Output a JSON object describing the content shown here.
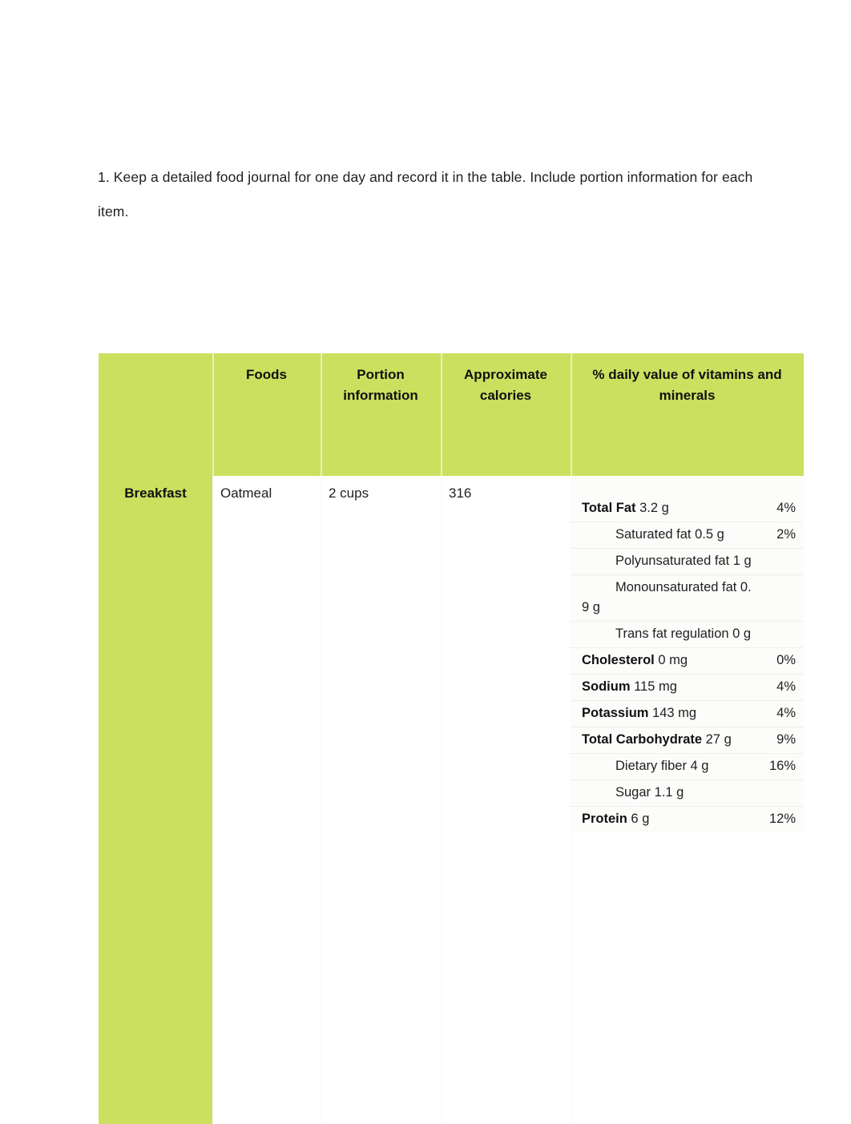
{
  "document": {
    "instruction": "1. Keep a detailed food journal for one day and record it in the table. Include portion information for each item."
  },
  "table": {
    "headers": {
      "corner": "",
      "foods": "Foods",
      "portion": "Portion information",
      "calories": "Approximate calories",
      "daily_value": "% daily value of vitamins and minerals"
    },
    "rows": [
      {
        "meal": "Breakfast",
        "food": "Oatmeal",
        "portion": "2 cups",
        "calories": "316",
        "nutrition": [
          {
            "name": "Total Fat",
            "amount": "3.2 g",
            "percent": "4%",
            "indent": false
          },
          {
            "name": "",
            "amount": "Saturated fat 0.5 g",
            "percent": "2%",
            "indent": true
          },
          {
            "name": "",
            "amount": "Polyunsaturated fat 1 g",
            "percent": "",
            "indent": true
          },
          {
            "name": "",
            "amount": "Monounsaturated fat 0.9 g",
            "percent": "",
            "indent": true
          },
          {
            "name": "",
            "amount": "Trans fat regulation 0 g",
            "percent": "",
            "indent": true
          },
          {
            "name": "Cholesterol",
            "amount": "0 mg",
            "percent": "0%",
            "indent": false
          },
          {
            "name": "Sodium",
            "amount": "115 mg",
            "percent": "4%",
            "indent": false
          },
          {
            "name": "Potassium",
            "amount": "143 mg",
            "percent": "4%",
            "indent": false
          },
          {
            "name": "Total Carbohydrate",
            "amount": "27 g",
            "percent": "9%",
            "indent": false
          },
          {
            "name": "",
            "amount": "Dietary fiber 4 g",
            "percent": "16%",
            "indent": true
          },
          {
            "name": "",
            "amount": "Sugar 1.1 g",
            "percent": "",
            "indent": true
          },
          {
            "name": "Protein",
            "amount": "6 g",
            "percent": "12%",
            "indent": false
          }
        ]
      }
    ]
  },
  "colors": {
    "header_green": "#cbe05f",
    "panel_background": "#fcfcfa",
    "text": "#1f1f1f"
  }
}
